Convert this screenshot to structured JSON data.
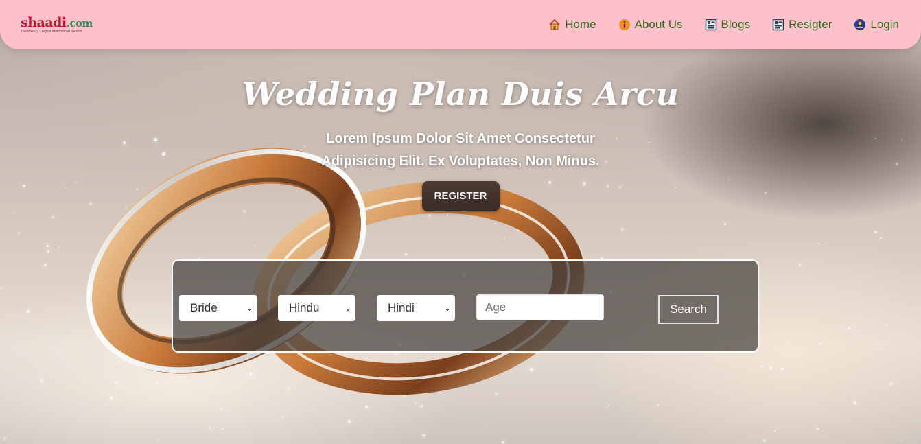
{
  "brand": {
    "name": "shaadi",
    "suffix": ".com",
    "tagline": "The World's Largest Matrimonial Service"
  },
  "nav": [
    {
      "label": "Home",
      "icon": "home-icon"
    },
    {
      "label": "About Us",
      "icon": "info-icon"
    },
    {
      "label": "Blogs",
      "icon": "blog-icon"
    },
    {
      "label": "Resigter",
      "icon": "register-icon"
    },
    {
      "label": "Login",
      "icon": "login-icon"
    }
  ],
  "hero": {
    "title": "Wedding Plan Duis Arcu",
    "subtitle": "Lorem Ipsum Dolor Sit Amet Consectetur Adipisicing Elit. Ex Voluptates, Non Minus.",
    "register_label": "REGISTER"
  },
  "search": {
    "looking_for": "Bride",
    "religion": "Hindu",
    "language": "Hindi",
    "age_placeholder": "Age",
    "button_label": "Search"
  },
  "colors": {
    "header_bg": "#ffc0cb",
    "nav_text": "#2f6b1f",
    "brand": "#c8102e"
  }
}
